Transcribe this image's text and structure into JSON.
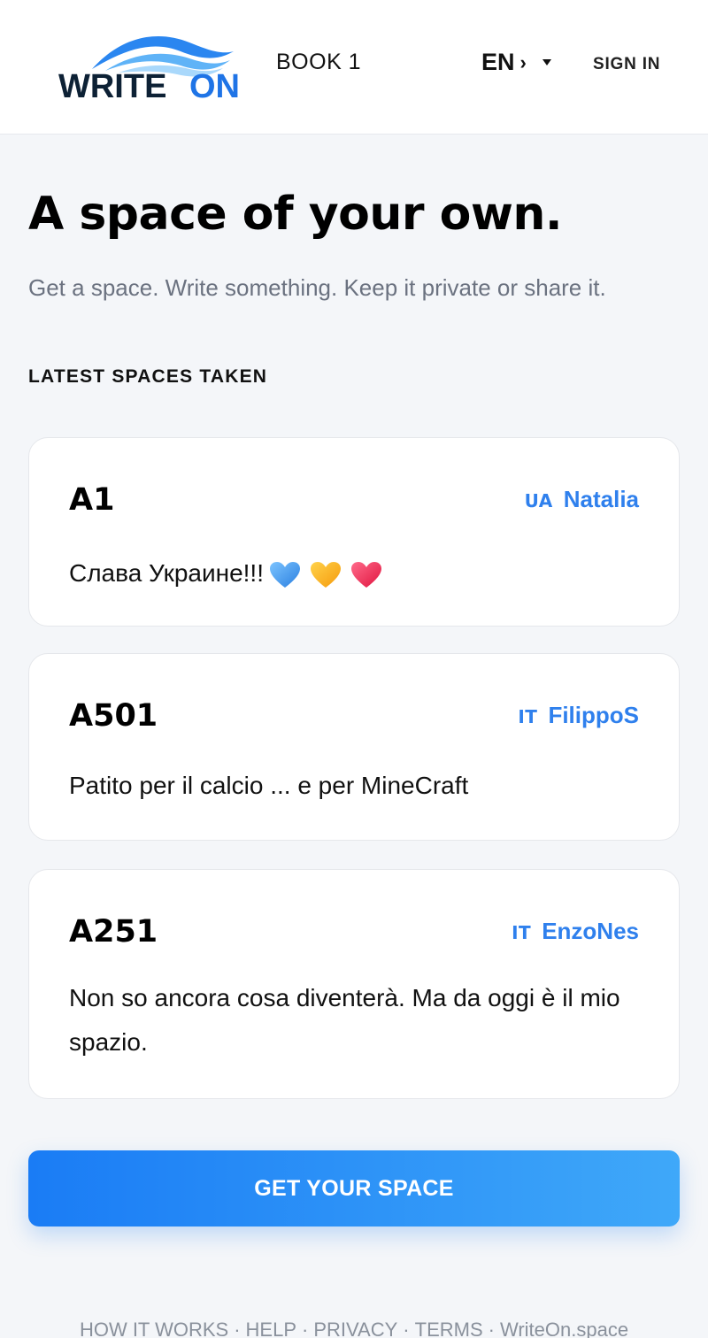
{
  "header": {
    "logo_text_dark": "WRITE",
    "logo_text_accent": "ON",
    "book_label": "BOOK 1",
    "lang_code": "EN",
    "lang_chevron": "›",
    "signin_label": "SIGN IN"
  },
  "hero": {
    "title": "A space of your own.",
    "subtitle": "Get a space. Write something. Keep it private or share it."
  },
  "latest": {
    "label": "LATEST SPACES TAKEN",
    "cards": [
      {
        "code": "A1",
        "country": "UA",
        "name": "Natalia",
        "text": "Слава Украине!!!"
      },
      {
        "code": "A501",
        "country": "IT",
        "name": "FilippoS",
        "text": "Patito per il calcio ... e per MineCraft"
      },
      {
        "code": "A251",
        "country": "IT",
        "name": "EnzoNes",
        "text": "Non so ancora cosa diventerà. Ma da oggi è il mio spazio."
      }
    ],
    "emoji_icons": [
      "blue-heart-icon",
      "yellow-heart-icon",
      "red-heart-icon"
    ]
  },
  "cta": {
    "label": "GET YOUR SPACE"
  },
  "footer": {
    "links": [
      "HOW IT WORKS",
      "HELP",
      "PRIVACY",
      "TERMS",
      "WriteOn.space"
    ],
    "separator": "·"
  },
  "colors": {
    "accent": "#2f80ed",
    "cta_start": "#1a7cf5",
    "cta_end": "#3fa8f9",
    "logo_dark": "#0d2135",
    "logo_blue": "#1f74e6"
  }
}
